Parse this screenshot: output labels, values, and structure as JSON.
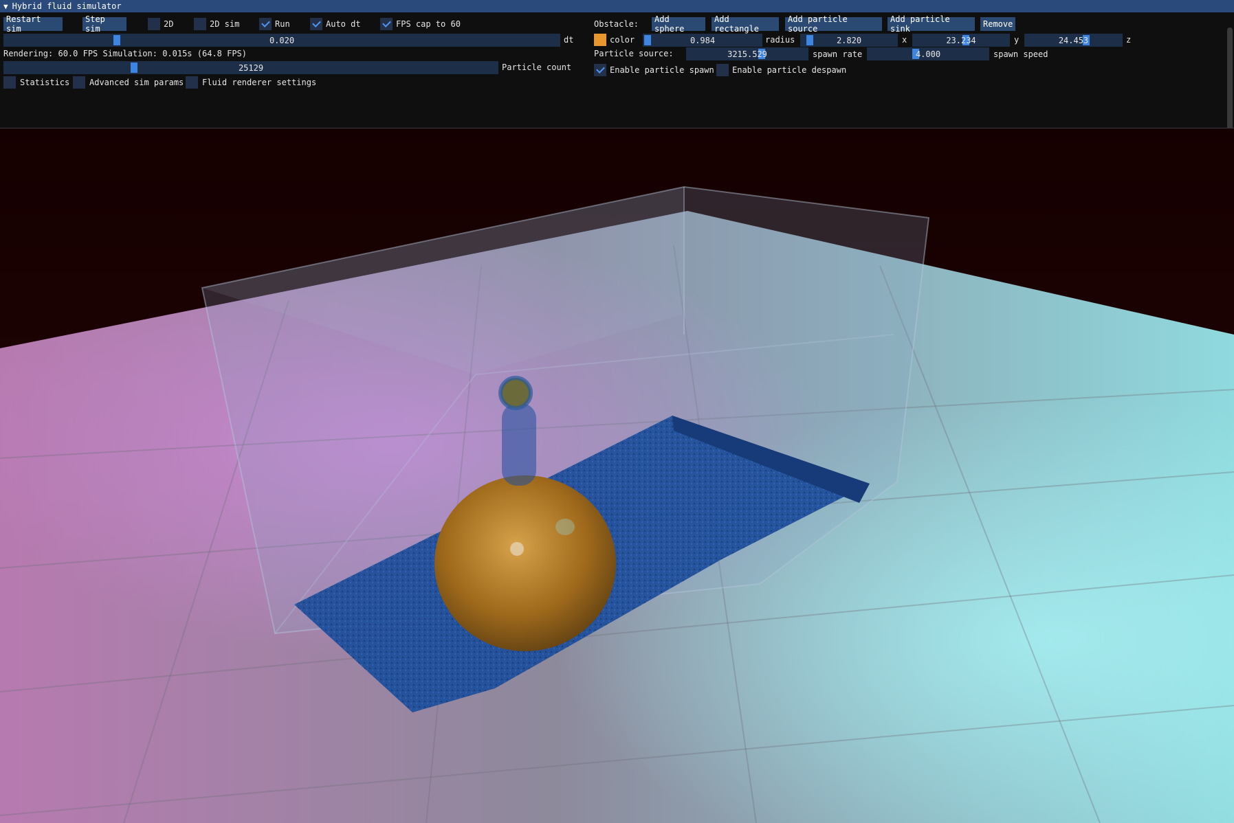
{
  "window": {
    "title": "Hybrid fluid simulator",
    "collapse_icon": "triangle-down-icon"
  },
  "controls": {
    "restart_label": "Restart sim",
    "step_label": "Step sim",
    "toggles": [
      {
        "label": "2D",
        "checked": false
      },
      {
        "label": "2D sim",
        "checked": false
      },
      {
        "label": "Run",
        "checked": true
      },
      {
        "label": "Auto dt",
        "checked": true
      },
      {
        "label": "FPS cap to 60",
        "checked": true
      }
    ],
    "dt_value": "0.020",
    "dt_label": "dt",
    "dt_fraction": 0.2,
    "status_text": "Rendering: 60.0 FPS  Simulation: 0.015s (64.8 FPS)",
    "particle_count_value": "25129",
    "particle_count_label": "Particle count",
    "particle_count_fraction": 0.26,
    "sections": [
      {
        "label": "Statistics",
        "checked": false
      },
      {
        "label": "Advanced sim params",
        "checked": false
      },
      {
        "label": "Fluid renderer settings",
        "checked": false
      }
    ]
  },
  "obstacle": {
    "label": "Obstacle:",
    "buttons": [
      "Add sphere",
      "Add rectangle",
      "Add particle source",
      "Add particle sink",
      "Remove"
    ],
    "color_hex": "#e8962e",
    "color_label": "color",
    "fields": [
      {
        "value": "0.984",
        "label": "radius"
      },
      {
        "value": "2.820",
        "label": "x"
      },
      {
        "value": "23.234",
        "label": "y"
      },
      {
        "value": "24.453",
        "label": "z"
      }
    ]
  },
  "particle_source": {
    "label": "Particle source:",
    "spawn_rate_value": "3215.529",
    "spawn_rate_label": "spawn rate",
    "spawn_speed_value": "4.000",
    "spawn_speed_label": "spawn speed",
    "enable_spawn_label": "Enable particle spawn",
    "enable_spawn_checked": true,
    "enable_despawn_label": "Enable particle despawn",
    "enable_despawn_checked": false
  },
  "colors": {
    "accent": "#3d85e0",
    "title_bar": "#294a7a",
    "button": "#2b4a73",
    "frame": "#1d2e48",
    "fluid": "#1d4f9e",
    "sphere": "#b07a1e"
  }
}
